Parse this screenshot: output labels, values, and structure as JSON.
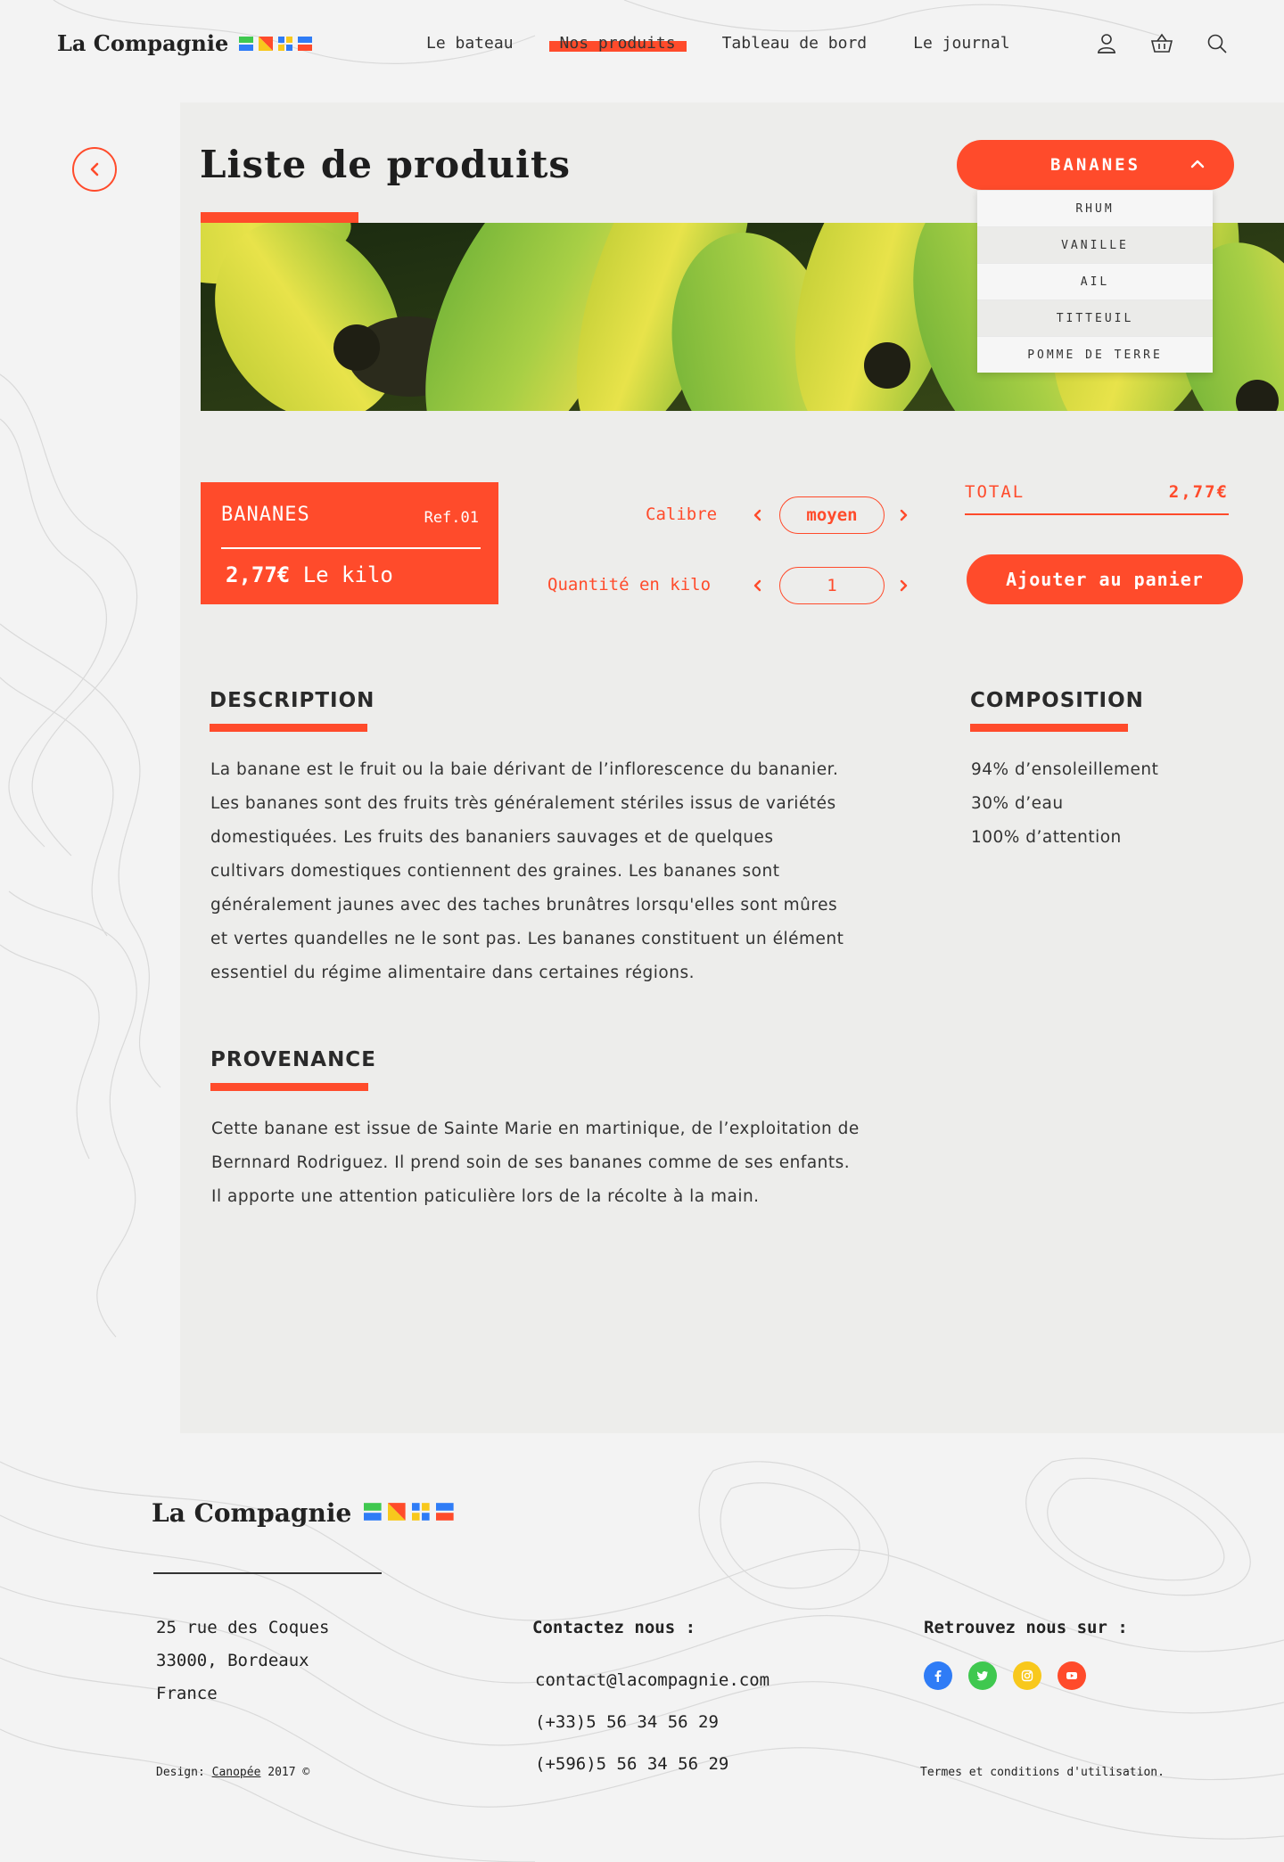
{
  "header": {
    "brand": "La Compagnie",
    "nav": [
      {
        "label": "Le bateau"
      },
      {
        "label": "Nos produits"
      },
      {
        "label": "Tableau de bord"
      },
      {
        "label": "Le journal"
      }
    ],
    "icons": [
      "user-icon",
      "basket-icon",
      "search-icon"
    ]
  },
  "colors": {
    "accent": "#ff4b2b",
    "panel": "#ededeb",
    "background": "#f3f3f3"
  },
  "page": {
    "title": "Liste de produits"
  },
  "dropdown": {
    "selected": "BANANES",
    "options": [
      "RHUM",
      "VANILLE",
      "AIL",
      "TITTEUIL",
      "POMME DE TERRE"
    ]
  },
  "product": {
    "name": "BANANES",
    "ref": "Ref.01",
    "price": "2,77€",
    "unit": "Le kilo"
  },
  "selectors": {
    "calibre_label": "Calibre",
    "calibre_value": "moyen",
    "quantity_label": "Quantité en kilo",
    "quantity_value": "1"
  },
  "total": {
    "label": "TOTAL",
    "value": "2,77€",
    "cart_button": "Ajouter au panier"
  },
  "description": {
    "title": "DESCRIPTION",
    "lines": [
      "La banane est le fruit ou la baie dérivant de l’inflorescence du bananier.",
      "Les bananes sont des fruits très généralement stériles issus de variétés",
      "domestiquées. Les fruits des bananiers sauvages et de quelques",
      "cultivars domestiques contiennent des graines. Les bananes sont",
      "généralement jaunes avec des taches brunâtres lorsqu'elles sont mûres",
      "et vertes quandelles ne le sont pas. Les bananes constituent un élément",
      "essentiel du régime alimentaire dans certaines régions."
    ]
  },
  "provenance": {
    "title": "PROVENANCE",
    "lines": [
      "Cette banane est issue de Sainte Marie en martinique, de l’exploitation de",
      "Bernnard Rodriguez. Il prend soin de ses bananes comme de ses enfants.",
      "Il apporte une attention paticulière lors de la récolte à la main."
    ]
  },
  "composition": {
    "title": "COMPOSITION",
    "items": [
      "94% d’ensoleillement",
      "30% d’eau",
      "100% d’attention"
    ]
  },
  "footer": {
    "brand": "La Compagnie",
    "address": [
      "25 rue des Coques",
      "33000, Bordeaux",
      "France"
    ],
    "contact_title": "Contactez nous :",
    "contacts": [
      "contact@lacompagnie.com",
      "(+33)5 56 34 56 29",
      "(+596)5 56 34 56 29"
    ],
    "social_title": "Retrouvez nous sur :",
    "socials": [
      {
        "icon": "facebook-icon",
        "color": "#2f7cf6"
      },
      {
        "icon": "twitter-icon",
        "color": "#3fc84f"
      },
      {
        "icon": "instagram-icon",
        "color": "#f8c81c"
      },
      {
        "icon": "youtube-icon",
        "color": "#ff4b2b"
      }
    ],
    "design_prefix": "Design: ",
    "design_link": "Canopée",
    "design_suffix": " 2017 ©",
    "terms": "Termes et conditions d'utilisation."
  }
}
